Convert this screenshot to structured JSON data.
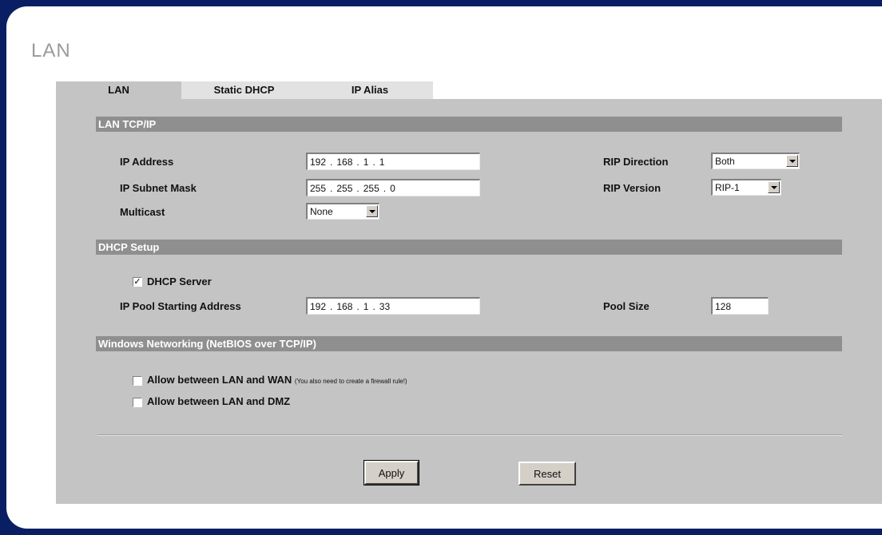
{
  "page": {
    "title": "LAN"
  },
  "tabs": [
    {
      "label": "LAN",
      "active": true
    },
    {
      "label": "Static DHCP",
      "active": false
    },
    {
      "label": "IP Alias",
      "active": false
    }
  ],
  "sections": {
    "lan_tcpip": "LAN TCP/IP",
    "dhcp_setup": "DHCP Setup",
    "windows_networking": "Windows Networking (NetBIOS over TCP/IP)"
  },
  "lan": {
    "ip_address_label": "IP Address",
    "ip_address": [
      "192",
      "168",
      "1",
      "1"
    ],
    "subnet_label": "IP Subnet Mask",
    "subnet": [
      "255",
      "255",
      "255",
      "0"
    ],
    "multicast_label": "Multicast",
    "multicast_value": "None",
    "rip_direction_label": "RIP Direction",
    "rip_direction_value": "Both",
    "rip_version_label": "RIP Version",
    "rip_version_value": "RIP-1"
  },
  "dhcp": {
    "server_label": "DHCP Server",
    "server_checked": true,
    "pool_start_label": "IP Pool Starting Address",
    "pool_start": [
      "192",
      "168",
      "1",
      "33"
    ],
    "pool_size_label": "Pool Size",
    "pool_size_value": "128"
  },
  "netbios": {
    "lan_wan_label": "Allow between LAN and WAN",
    "lan_wan_note": "(You also need to create a firewall rule!)",
    "lan_wan_checked": false,
    "lan_dmz_label": "Allow between LAN and DMZ",
    "lan_dmz_checked": false
  },
  "buttons": {
    "apply": "Apply",
    "reset": "Reset"
  },
  "ip_separator": "."
}
